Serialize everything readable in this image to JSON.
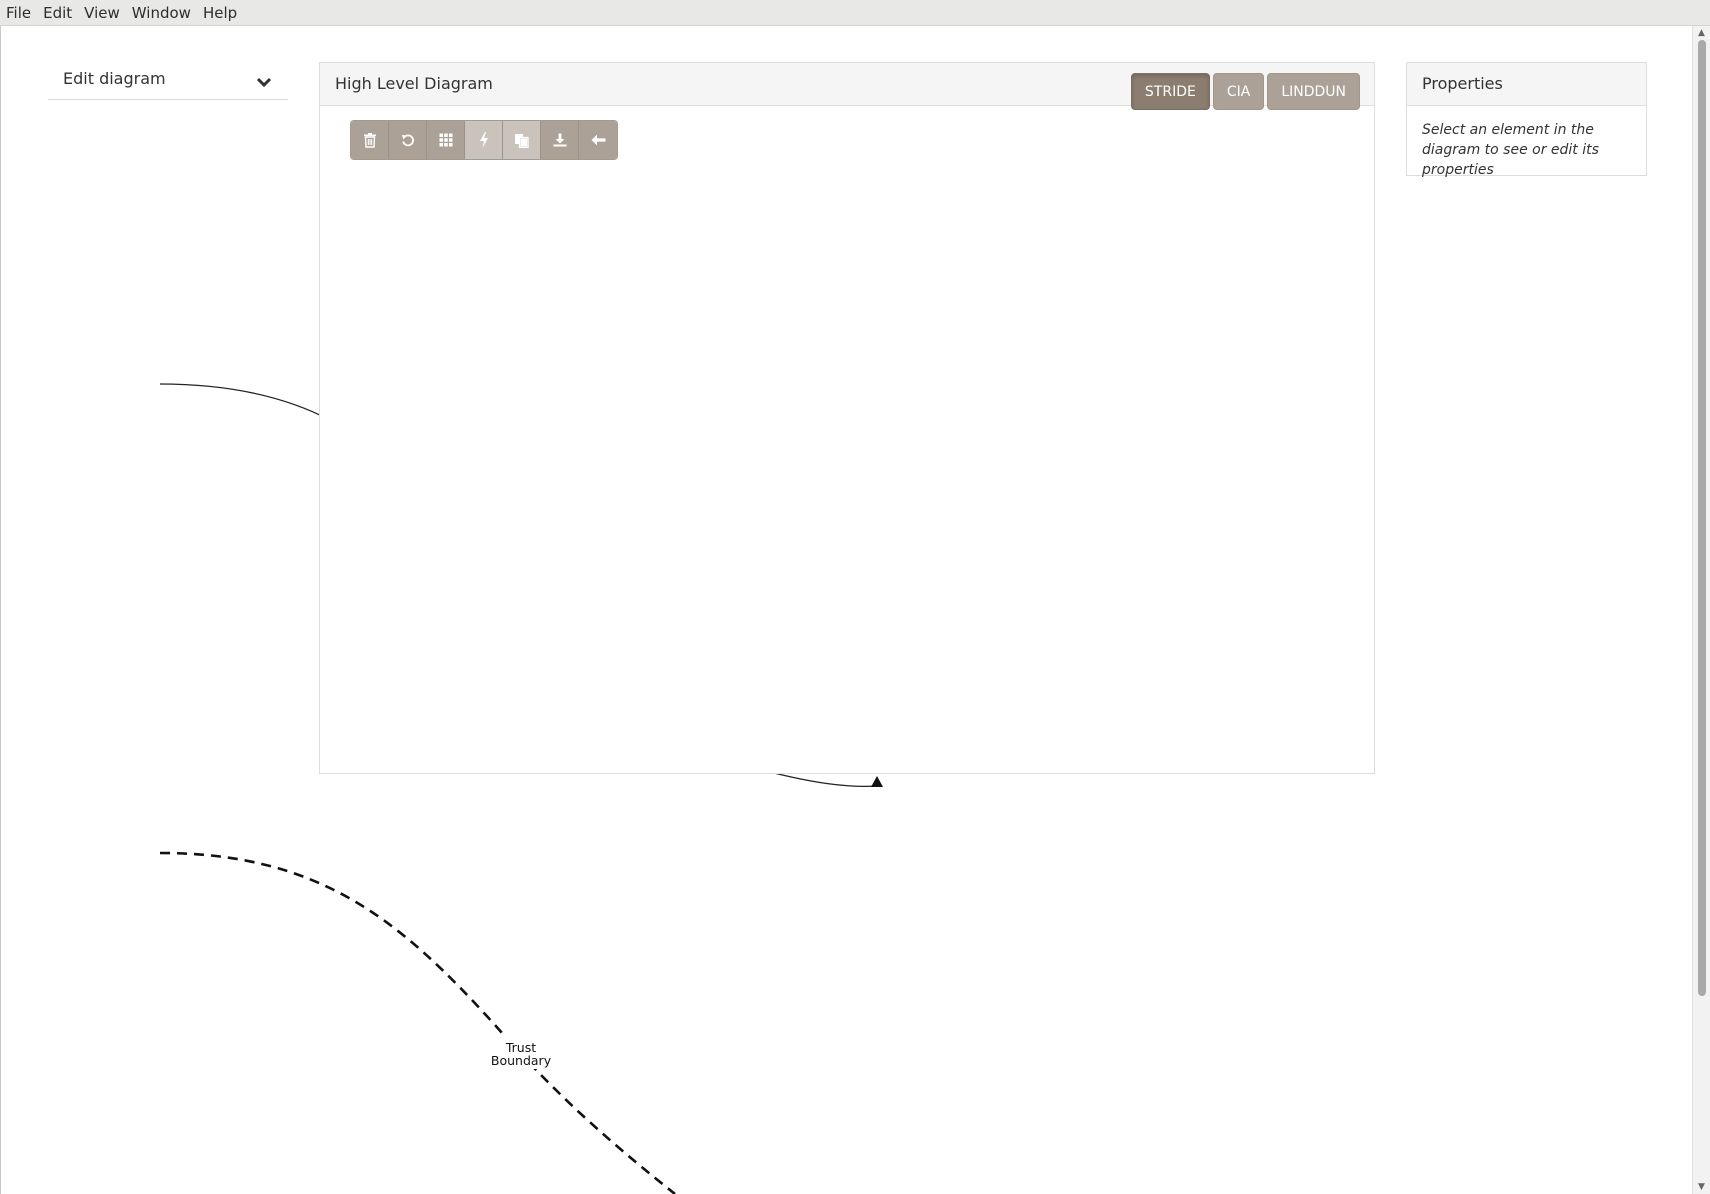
{
  "menubar": {
    "items": [
      "File",
      "Edit",
      "View",
      "Window",
      "Help"
    ]
  },
  "sidebar": {
    "edit_diagram_label": "Edit diagram",
    "edit_diagram_icon": "chevron-down-icon"
  },
  "diagram_panel": {
    "title": "High Level Diagram",
    "methods": [
      {
        "label": "STRIDE",
        "active": true
      },
      {
        "label": "CIA",
        "active": false
      },
      {
        "label": "LINDDUN",
        "active": false
      }
    ],
    "toolbar": [
      {
        "icon": "trash-icon",
        "enabled": true
      },
      {
        "icon": "undo-icon",
        "enabled": true
      },
      {
        "icon": "grid-icon",
        "enabled": true
      },
      {
        "icon": "lightning-icon",
        "enabled": false
      },
      {
        "icon": "copy-icon",
        "enabled": false
      },
      {
        "icon": "download-icon",
        "enabled": true
      },
      {
        "icon": "arrow-left-icon",
        "enabled": true
      }
    ]
  },
  "properties": {
    "title": "Properties",
    "hint": "Select an element in the diagram to see or edit its properties"
  },
  "diagram": {
    "trust_boundary_label_line1": "Trust",
    "trust_boundary_label_line2": "Boundary"
  },
  "colors": {
    "button_bg": "#aba196",
    "button_active_bg": "#8b7e70",
    "button_disabled_bg": "#c9c3bc",
    "panel_heading_bg": "#f5f5f5",
    "menubar_bg": "#e8e8e7"
  }
}
